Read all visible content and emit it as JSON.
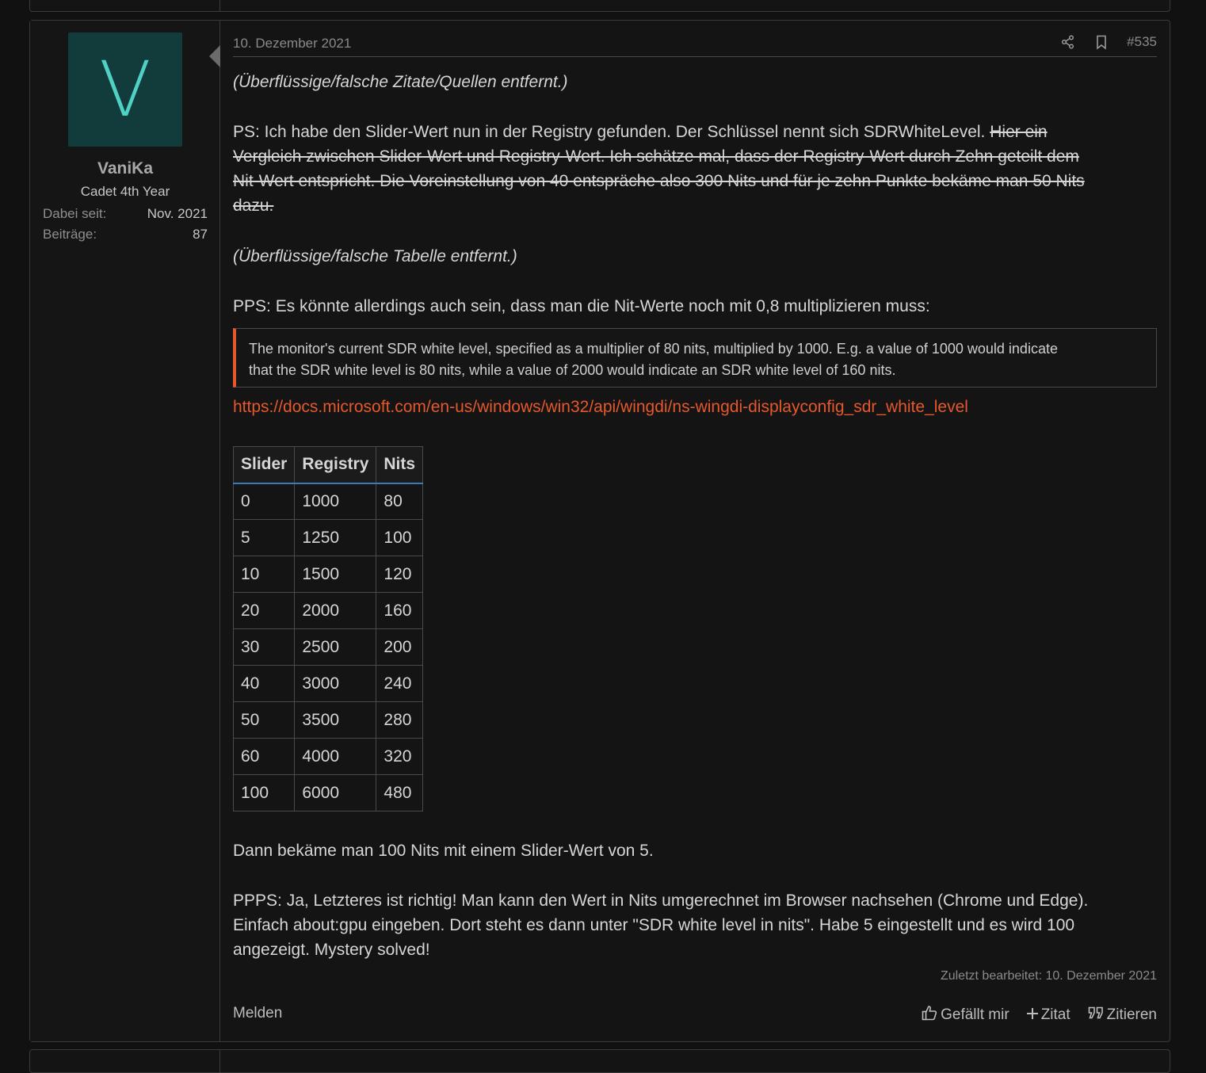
{
  "user": {
    "avatar_letter": "V",
    "name": "VaniKa",
    "title": "Cadet 4th Year",
    "stats": [
      {
        "label": "Dabei seit:",
        "value": "Nov. 2021"
      },
      {
        "label": "Beiträge:",
        "value": "87"
      }
    ]
  },
  "post": {
    "date": "10. Dezember 2021",
    "number": "#535",
    "p1": "(Überflüssige/falsche Zitate/Quellen entfernt.)",
    "p2_l1_normal": "PS: Ich habe den Slider-Wert nun in der Registry gefunden. Der Schlüssel nennt sich SDRWhiteLevel. ",
    "p2_l1_strike": "Hier ein",
    "p2_l2": "Vergleich zwischen Slider-Wert und Registry-Wert. Ich schätze mal, dass der Registry-Wert durch Zehn geteilt dem",
    "p2_l3": "Nit-Wert entspricht. Die Voreinstellung von 40 entspräche also 300 Nits und für je zehn Punkte bekäme man 50 Nits",
    "p2_l4": "dazu.",
    "p3": "(Überflüssige/falsche Tabelle entfernt.)",
    "p4": "PPS: Es könnte allerdings auch sein, dass man die Nit-Werte noch mit 0,8 multiplizieren muss:",
    "quote_l1": "The monitor's current SDR white level, specified as a multiplier of 80 nits, multiplied by 1000. E.g. a value of 1000 would indicate",
    "quote_l2": "that the SDR white level is 80 nits, while a value of 2000 would indicate an SDR white level of 160 nits.",
    "link": "https://docs.microsoft.com/en-us/windows/win32/api/wingdi/ns-wingdi-displayconfig_sdr_white_level",
    "table": {
      "headers": [
        "Slider",
        "Registry",
        "Nits"
      ],
      "rows": [
        [
          "0",
          "1000",
          "80"
        ],
        [
          "5",
          "1250",
          "100"
        ],
        [
          "10",
          "1500",
          "120"
        ],
        [
          "20",
          "2000",
          "160"
        ],
        [
          "30",
          "2500",
          "200"
        ],
        [
          "40",
          "3000",
          "240"
        ],
        [
          "50",
          "3500",
          "280"
        ],
        [
          "60",
          "4000",
          "320"
        ],
        [
          "100",
          "6000",
          "480"
        ]
      ]
    },
    "p5": "Dann bekäme man 100 Nits mit einem Slider-Wert von 5.",
    "p6_l1": "PPPS: Ja, Letzteres ist richtig! Man kann den Wert in Nits umgerechnet im Browser nachsehen (Chrome und Edge).",
    "p6_l2": "Einfach about:gpu eingeben. Dort steht es dann unter \"SDR white level in nits\". Habe 5 eingestellt und es wird 100",
    "p6_l3": "angezeigt. Mystery solved!",
    "edited": "Zuletzt bearbeitet: 10. Dezember 2021"
  },
  "footer": {
    "report": "Melden",
    "like": "Gefällt mir",
    "quote": "Zitat",
    "reply": "Zitieren"
  },
  "colors": {
    "accent": "#e5582c",
    "avatar_bg": "#123c3c",
    "avatar_fg": "#4fd1c5",
    "table_header_border": "#3d7ab8"
  }
}
